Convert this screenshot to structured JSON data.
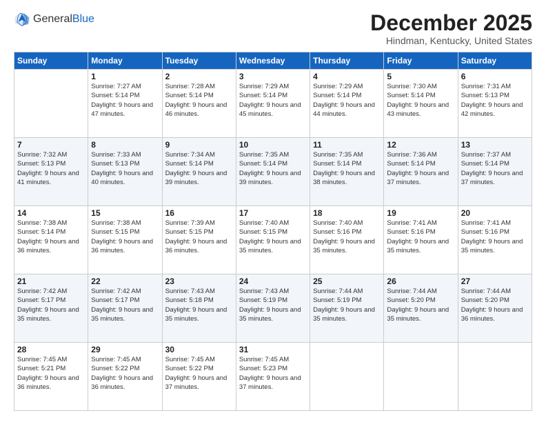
{
  "logo": {
    "general": "General",
    "blue": "Blue"
  },
  "header": {
    "month": "December 2025",
    "location": "Hindman, Kentucky, United States"
  },
  "days_of_week": [
    "Sunday",
    "Monday",
    "Tuesday",
    "Wednesday",
    "Thursday",
    "Friday",
    "Saturday"
  ],
  "weeks": [
    [
      {
        "day": "",
        "sunrise": "",
        "sunset": "",
        "daylight": ""
      },
      {
        "day": "1",
        "sunrise": "Sunrise: 7:27 AM",
        "sunset": "Sunset: 5:14 PM",
        "daylight": "Daylight: 9 hours and 47 minutes."
      },
      {
        "day": "2",
        "sunrise": "Sunrise: 7:28 AM",
        "sunset": "Sunset: 5:14 PM",
        "daylight": "Daylight: 9 hours and 46 minutes."
      },
      {
        "day": "3",
        "sunrise": "Sunrise: 7:29 AM",
        "sunset": "Sunset: 5:14 PM",
        "daylight": "Daylight: 9 hours and 45 minutes."
      },
      {
        "day": "4",
        "sunrise": "Sunrise: 7:29 AM",
        "sunset": "Sunset: 5:14 PM",
        "daylight": "Daylight: 9 hours and 44 minutes."
      },
      {
        "day": "5",
        "sunrise": "Sunrise: 7:30 AM",
        "sunset": "Sunset: 5:14 PM",
        "daylight": "Daylight: 9 hours and 43 minutes."
      },
      {
        "day": "6",
        "sunrise": "Sunrise: 7:31 AM",
        "sunset": "Sunset: 5:13 PM",
        "daylight": "Daylight: 9 hours and 42 minutes."
      }
    ],
    [
      {
        "day": "7",
        "sunrise": "Sunrise: 7:32 AM",
        "sunset": "Sunset: 5:13 PM",
        "daylight": "Daylight: 9 hours and 41 minutes."
      },
      {
        "day": "8",
        "sunrise": "Sunrise: 7:33 AM",
        "sunset": "Sunset: 5:13 PM",
        "daylight": "Daylight: 9 hours and 40 minutes."
      },
      {
        "day": "9",
        "sunrise": "Sunrise: 7:34 AM",
        "sunset": "Sunset: 5:14 PM",
        "daylight": "Daylight: 9 hours and 39 minutes."
      },
      {
        "day": "10",
        "sunrise": "Sunrise: 7:35 AM",
        "sunset": "Sunset: 5:14 PM",
        "daylight": "Daylight: 9 hours and 39 minutes."
      },
      {
        "day": "11",
        "sunrise": "Sunrise: 7:35 AM",
        "sunset": "Sunset: 5:14 PM",
        "daylight": "Daylight: 9 hours and 38 minutes."
      },
      {
        "day": "12",
        "sunrise": "Sunrise: 7:36 AM",
        "sunset": "Sunset: 5:14 PM",
        "daylight": "Daylight: 9 hours and 37 minutes."
      },
      {
        "day": "13",
        "sunrise": "Sunrise: 7:37 AM",
        "sunset": "Sunset: 5:14 PM",
        "daylight": "Daylight: 9 hours and 37 minutes."
      }
    ],
    [
      {
        "day": "14",
        "sunrise": "Sunrise: 7:38 AM",
        "sunset": "Sunset: 5:14 PM",
        "daylight": "Daylight: 9 hours and 36 minutes."
      },
      {
        "day": "15",
        "sunrise": "Sunrise: 7:38 AM",
        "sunset": "Sunset: 5:15 PM",
        "daylight": "Daylight: 9 hours and 36 minutes."
      },
      {
        "day": "16",
        "sunrise": "Sunrise: 7:39 AM",
        "sunset": "Sunset: 5:15 PM",
        "daylight": "Daylight: 9 hours and 36 minutes."
      },
      {
        "day": "17",
        "sunrise": "Sunrise: 7:40 AM",
        "sunset": "Sunset: 5:15 PM",
        "daylight": "Daylight: 9 hours and 35 minutes."
      },
      {
        "day": "18",
        "sunrise": "Sunrise: 7:40 AM",
        "sunset": "Sunset: 5:16 PM",
        "daylight": "Daylight: 9 hours and 35 minutes."
      },
      {
        "day": "19",
        "sunrise": "Sunrise: 7:41 AM",
        "sunset": "Sunset: 5:16 PM",
        "daylight": "Daylight: 9 hours and 35 minutes."
      },
      {
        "day": "20",
        "sunrise": "Sunrise: 7:41 AM",
        "sunset": "Sunset: 5:16 PM",
        "daylight": "Daylight: 9 hours and 35 minutes."
      }
    ],
    [
      {
        "day": "21",
        "sunrise": "Sunrise: 7:42 AM",
        "sunset": "Sunset: 5:17 PM",
        "daylight": "Daylight: 9 hours and 35 minutes."
      },
      {
        "day": "22",
        "sunrise": "Sunrise: 7:42 AM",
        "sunset": "Sunset: 5:17 PM",
        "daylight": "Daylight: 9 hours and 35 minutes."
      },
      {
        "day": "23",
        "sunrise": "Sunrise: 7:43 AM",
        "sunset": "Sunset: 5:18 PM",
        "daylight": "Daylight: 9 hours and 35 minutes."
      },
      {
        "day": "24",
        "sunrise": "Sunrise: 7:43 AM",
        "sunset": "Sunset: 5:19 PM",
        "daylight": "Daylight: 9 hours and 35 minutes."
      },
      {
        "day": "25",
        "sunrise": "Sunrise: 7:44 AM",
        "sunset": "Sunset: 5:19 PM",
        "daylight": "Daylight: 9 hours and 35 minutes."
      },
      {
        "day": "26",
        "sunrise": "Sunrise: 7:44 AM",
        "sunset": "Sunset: 5:20 PM",
        "daylight": "Daylight: 9 hours and 35 minutes."
      },
      {
        "day": "27",
        "sunrise": "Sunrise: 7:44 AM",
        "sunset": "Sunset: 5:20 PM",
        "daylight": "Daylight: 9 hours and 36 minutes."
      }
    ],
    [
      {
        "day": "28",
        "sunrise": "Sunrise: 7:45 AM",
        "sunset": "Sunset: 5:21 PM",
        "daylight": "Daylight: 9 hours and 36 minutes."
      },
      {
        "day": "29",
        "sunrise": "Sunrise: 7:45 AM",
        "sunset": "Sunset: 5:22 PM",
        "daylight": "Daylight: 9 hours and 36 minutes."
      },
      {
        "day": "30",
        "sunrise": "Sunrise: 7:45 AM",
        "sunset": "Sunset: 5:22 PM",
        "daylight": "Daylight: 9 hours and 37 minutes."
      },
      {
        "day": "31",
        "sunrise": "Sunrise: 7:45 AM",
        "sunset": "Sunset: 5:23 PM",
        "daylight": "Daylight: 9 hours and 37 minutes."
      },
      {
        "day": "",
        "sunrise": "",
        "sunset": "",
        "daylight": ""
      },
      {
        "day": "",
        "sunrise": "",
        "sunset": "",
        "daylight": ""
      },
      {
        "day": "",
        "sunrise": "",
        "sunset": "",
        "daylight": ""
      }
    ]
  ]
}
